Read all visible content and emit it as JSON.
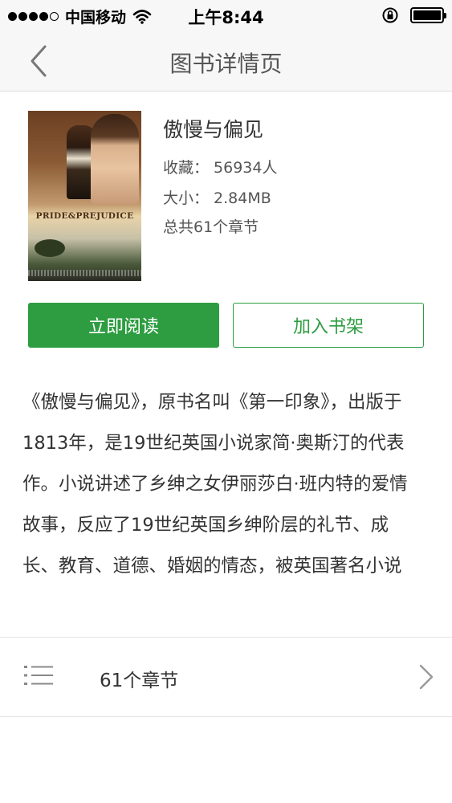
{
  "status_bar": {
    "carrier": "中国移动",
    "time": "上午8:44"
  },
  "nav": {
    "title": "图书详情页"
  },
  "book": {
    "title": "傲慢与偏见",
    "favorites": "收藏：  56934人",
    "size": "大小：  2.84MB",
    "chapters_total": "总共61个章节",
    "cover_text": "PRIDE&PREJUDICE"
  },
  "actions": {
    "read_label": "立即阅读",
    "shelf_label": "加入书架"
  },
  "intro": {
    "text": "《傲慢与偏见》，原书名叫《第一印象》，出版于1813年，是19世纪英国小说家简·奥斯汀的代表作。小说讲述了乡绅之女伊丽莎白·班内特的爱情故事，反应了19世纪英国乡绅阶层的礼节、成长、教育、道德、婚姻的情态，被英国著名小说"
  },
  "chapters_row": {
    "label": "61个章节"
  }
}
